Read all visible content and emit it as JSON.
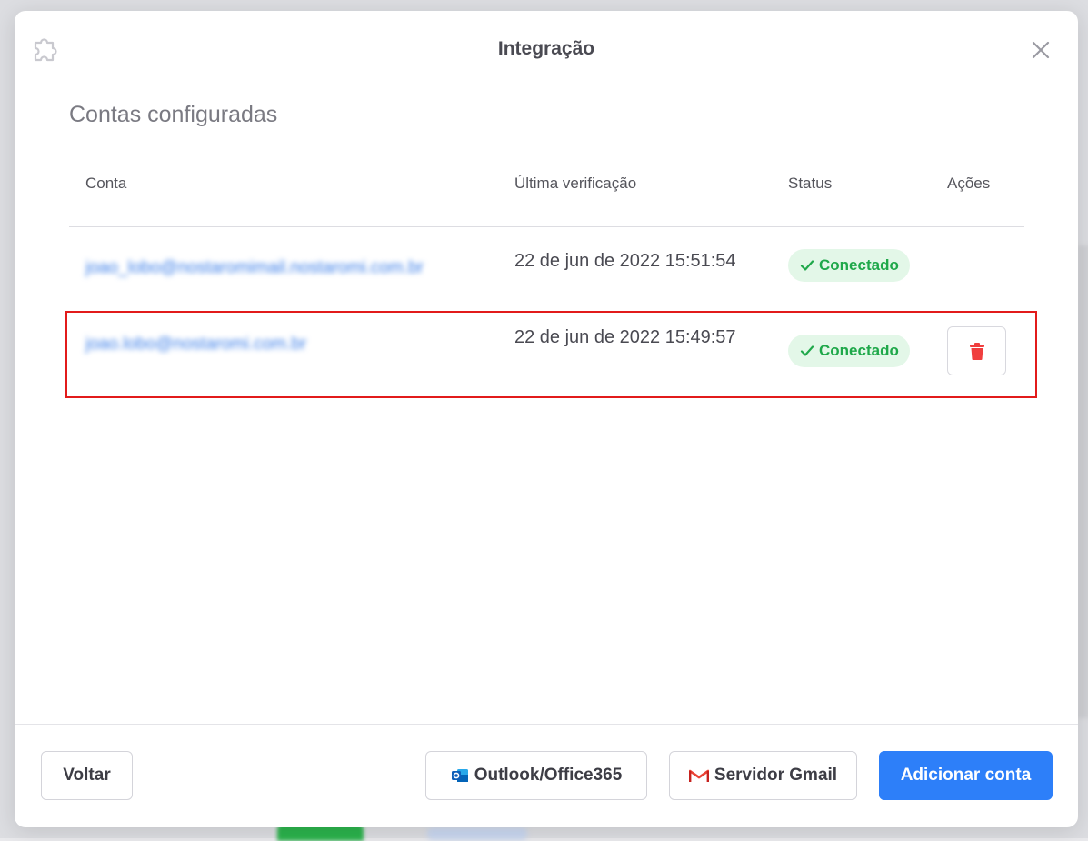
{
  "dialog": {
    "title": "Integração",
    "section_title": "Contas configuradas"
  },
  "table": {
    "columns": {
      "account": "Conta",
      "last_check": "Última verificação",
      "status": "Status",
      "actions": "Ações"
    },
    "rows": [
      {
        "email": "joao_lobo@nostaromimail.nostaromi.com.br",
        "last_check": "22 de jun de 2022 15:51:54",
        "status": "Conectado"
      },
      {
        "email": "joao.lobo@nostaromi.com.br",
        "last_check": "22 de jun de 2022 15:49:57",
        "status": "Conectado"
      }
    ]
  },
  "footer": {
    "back_label": "Voltar",
    "outlook_label": "Outlook/Office365",
    "gmail_label": "Servidor Gmail",
    "add_label": "Adicionar conta"
  },
  "colors": {
    "accent": "#2d7ff9",
    "status_green": "#1fa84a",
    "delete_red": "#f03e3e",
    "highlight_red": "#e21b1b"
  }
}
